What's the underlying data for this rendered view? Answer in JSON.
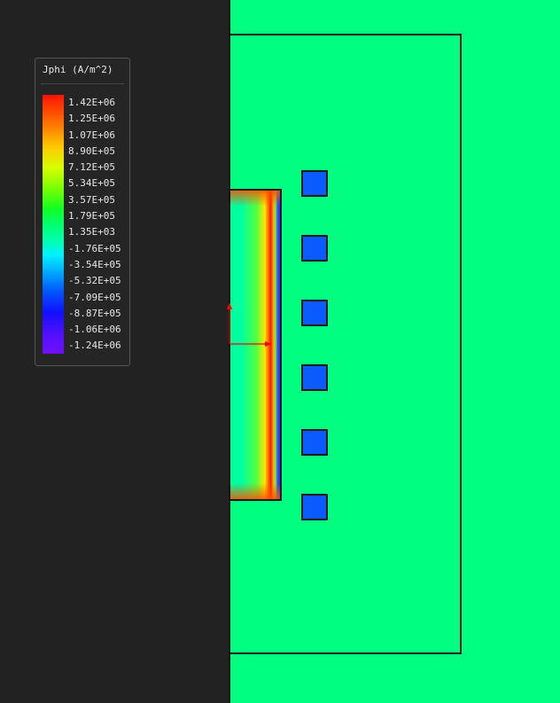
{
  "legend": {
    "title": "Jphi (A/m^2)",
    "labels": [
      "1.42E+06",
      "1.25E+06",
      "1.07E+06",
      "8.90E+05",
      "7.12E+05",
      "5.34E+05",
      "3.57E+05",
      "1.79E+05",
      "1.35E+03",
      "-1.76E+05",
      "-3.54E+05",
      "-5.32E+05",
      "-7.09E+05",
      "-8.87E+05",
      "-1.06E+06",
      "-1.24E+06"
    ],
    "colors_top_to_bottom": [
      "#ff1400",
      "#ff7a00",
      "#ffc800",
      "#d8ff00",
      "#7cff00",
      "#10ff20",
      "#00ff70",
      "#00ffa8",
      "#00f0ff",
      "#00b0ff",
      "#0060ff",
      "#1010ff",
      "#5010ff",
      "#7010ff"
    ]
  },
  "scene": {
    "background_color": "#222222",
    "field_color": "#00ff80",
    "coil_color": "#0a5cff",
    "axis_arrow_color": "#ff0000",
    "coil_count": 6
  }
}
